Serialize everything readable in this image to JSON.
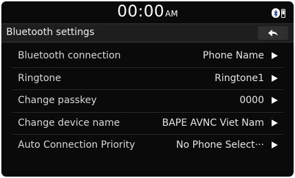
{
  "status": {
    "time": "00:00",
    "ampm": "AM",
    "icons": [
      "bluetooth-icon",
      "phone-icon"
    ]
  },
  "header": {
    "title": "Bluetooth settings",
    "back_icon": "back-arrow-icon"
  },
  "rows": [
    {
      "label": "Bluetooth connection",
      "value": "Phone Name"
    },
    {
      "label": "Ringtone",
      "value": "Ringtone1"
    },
    {
      "label": "Change passkey",
      "value": "0000"
    },
    {
      "label": "Change device name",
      "value": "BAPE AVNC Viet Nam"
    },
    {
      "label": "Auto Connection Priority",
      "value": "No Phone Select···"
    }
  ],
  "colors": {
    "background": "#0a0a0a",
    "header": "#1e1e1e",
    "text": "#d8d8d8"
  }
}
